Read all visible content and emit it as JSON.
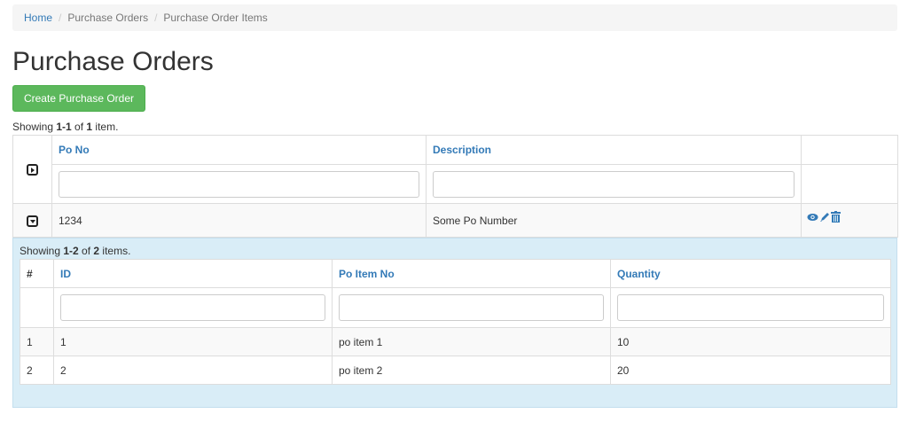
{
  "breadcrumb": {
    "home": "Home",
    "separator": "/",
    "purchase_orders": "Purchase Orders",
    "current": "Purchase Order Items"
  },
  "page_title": "Purchase Orders",
  "create_button": "Create Purchase Order",
  "summary": {
    "prefix": "Showing ",
    "range": "1-1",
    "of": " of ",
    "total": "1",
    "suffix": " item."
  },
  "main_table": {
    "columns": [
      "Po No",
      "Description"
    ],
    "rows": [
      {
        "po_no": "1234",
        "description": "Some Po Number"
      }
    ]
  },
  "detail": {
    "summary": {
      "prefix": "Showing ",
      "range": "1-2",
      "of": " of ",
      "total": "2",
      "suffix": " items."
    },
    "columns": [
      "#",
      "ID",
      "Po Item No",
      "Quantity"
    ],
    "rows": [
      {
        "num": "1",
        "id": "1",
        "po_item_no": "po item 1",
        "quantity": "10"
      },
      {
        "num": "2",
        "id": "2",
        "po_item_no": "po item 2",
        "quantity": "20"
      }
    ]
  },
  "colors": {
    "link": "#337ab7",
    "success": "#5cb85c",
    "detail_bg": "#d9edf7",
    "stripe": "#f9f9f9"
  },
  "icons": [
    "expand-icon",
    "collapse-icon",
    "view-icon",
    "edit-icon",
    "delete-icon"
  ]
}
